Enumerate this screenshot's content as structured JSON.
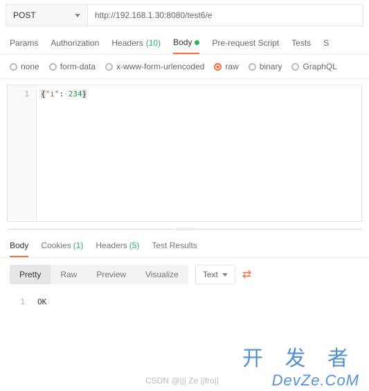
{
  "request": {
    "method": "POST",
    "url": "http://192.168.1.30:8080/test6/e"
  },
  "req_tabs": {
    "params": "Params",
    "auth": "Authorization",
    "headers_label": "Headers",
    "headers_count": "(10)",
    "body": "Body",
    "prerequest": "Pre-request Script",
    "tests": "Tests",
    "settings_partial": "S"
  },
  "body_types": {
    "none": "none",
    "formdata": "form-data",
    "urlencoded": "x-www-form-urlencoded",
    "raw": "raw",
    "binary": "binary",
    "graphql": "GraphQL"
  },
  "editor": {
    "line_no": "1",
    "open": "{",
    "key": "\"i\"",
    "sep": ":",
    "dots": "·",
    "value": "234",
    "close": "}"
  },
  "resp_tabs": {
    "body": "Body",
    "cookies_label": "Cookies",
    "cookies_count": "(1)",
    "headers_label": "Headers",
    "headers_count": "(5)",
    "tests": "Test Results"
  },
  "view_modes": {
    "pretty": "Pretty",
    "raw": "Raw",
    "preview": "Preview",
    "visualize": "Visualize"
  },
  "lang": "Text",
  "response": {
    "line_no": "1",
    "body": "OK"
  },
  "watermark": {
    "cn": "开 发 者",
    "en": "DevZe.CoM",
    "csdn": "CSDN @||| Ze ||fro||"
  }
}
